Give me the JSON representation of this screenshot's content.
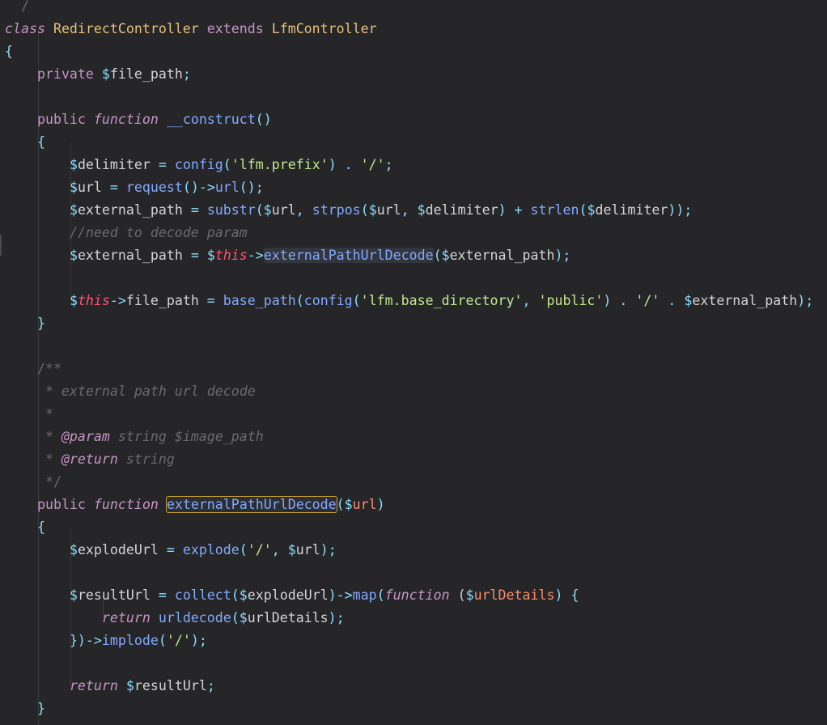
{
  "colors": {
    "background": "#262629",
    "keyword": "#c594c5",
    "class": "#e5c07b",
    "function": "#82aaff",
    "variable": "#d4d4d4",
    "string": "#c3e88d",
    "comment": "#6b6b6b",
    "this": "#ff5370",
    "param": "#f78c6c",
    "punctuation": "#89ddff",
    "highlight_border": "#c8a22c"
  },
  "lines": [
    [
      {
        "t": "  /",
        "c": "comment"
      }
    ],
    [
      {
        "t": "class",
        "c": "keyword",
        "i": true
      },
      {
        "t": " "
      },
      {
        "t": "RedirectController",
        "c": "class"
      },
      {
        "t": " "
      },
      {
        "t": "extends",
        "c": "keyword"
      },
      {
        "t": " "
      },
      {
        "t": "LfmController",
        "c": "class"
      }
    ],
    [
      {
        "t": "{",
        "c": "punctuation"
      }
    ],
    [
      {
        "t": "    "
      },
      {
        "t": "private",
        "c": "keyword"
      },
      {
        "t": " "
      },
      {
        "t": "$",
        "c": "punctuation"
      },
      {
        "t": "file_path"
      },
      {
        "t": ";",
        "c": "punctuation"
      }
    ],
    [],
    [
      {
        "t": "    "
      },
      {
        "t": "public",
        "c": "keyword"
      },
      {
        "t": " "
      },
      {
        "t": "function",
        "c": "keyword",
        "i": true
      },
      {
        "t": " "
      },
      {
        "t": "__construct",
        "c": "function"
      },
      {
        "t": "()",
        "c": "punctuation"
      }
    ],
    [
      {
        "t": "    "
      },
      {
        "t": "{",
        "c": "punctuation"
      }
    ],
    [
      {
        "t": "        "
      },
      {
        "t": "$",
        "c": "punctuation"
      },
      {
        "t": "delimiter "
      },
      {
        "t": "=",
        "c": "punctuation"
      },
      {
        "t": " "
      },
      {
        "t": "config",
        "c": "function"
      },
      {
        "t": "(",
        "c": "punctuation"
      },
      {
        "t": "'lfm.prefix'",
        "c": "string"
      },
      {
        "t": ")",
        "c": "punctuation"
      },
      {
        "t": " . ",
        "c": "punctuation"
      },
      {
        "t": "'/'",
        "c": "string"
      },
      {
        "t": ";",
        "c": "punctuation"
      }
    ],
    [
      {
        "t": "        "
      },
      {
        "t": "$",
        "c": "punctuation"
      },
      {
        "t": "url "
      },
      {
        "t": "=",
        "c": "punctuation"
      },
      {
        "t": " "
      },
      {
        "t": "request",
        "c": "function"
      },
      {
        "t": "()->",
        "c": "punctuation"
      },
      {
        "t": "url",
        "c": "function"
      },
      {
        "t": "();",
        "c": "punctuation"
      }
    ],
    [
      {
        "t": "        "
      },
      {
        "t": "$",
        "c": "punctuation"
      },
      {
        "t": "external_path "
      },
      {
        "t": "=",
        "c": "punctuation"
      },
      {
        "t": " "
      },
      {
        "t": "substr",
        "c": "function"
      },
      {
        "t": "(",
        "c": "punctuation"
      },
      {
        "t": "$",
        "c": "punctuation"
      },
      {
        "t": "url"
      },
      {
        "t": ", ",
        "c": "punctuation"
      },
      {
        "t": "strpos",
        "c": "function"
      },
      {
        "t": "(",
        "c": "punctuation"
      },
      {
        "t": "$",
        "c": "punctuation"
      },
      {
        "t": "url"
      },
      {
        "t": ", ",
        "c": "punctuation"
      },
      {
        "t": "$",
        "c": "punctuation"
      },
      {
        "t": "delimiter"
      },
      {
        "t": ") + ",
        "c": "punctuation"
      },
      {
        "t": "strlen",
        "c": "function"
      },
      {
        "t": "(",
        "c": "punctuation"
      },
      {
        "t": "$",
        "c": "punctuation"
      },
      {
        "t": "delimiter"
      },
      {
        "t": "));",
        "c": "punctuation"
      }
    ],
    [
      {
        "t": "        "
      },
      {
        "t": "//need to decode param",
        "c": "comment",
        "i": true
      }
    ],
    [
      {
        "t": "        "
      },
      {
        "t": "$",
        "c": "punctuation"
      },
      {
        "t": "external_path "
      },
      {
        "t": "=",
        "c": "punctuation"
      },
      {
        "t": " "
      },
      {
        "t": "$",
        "c": "punctuation"
      },
      {
        "t": "this",
        "c": "this",
        "i": true
      },
      {
        "t": "->",
        "c": "punctuation"
      },
      {
        "t": "externalPathUrlDecode",
        "c": "function",
        "sel": true
      },
      {
        "t": "(",
        "c": "punctuation"
      },
      {
        "t": "$",
        "c": "punctuation"
      },
      {
        "t": "external_path"
      },
      {
        "t": ");",
        "c": "punctuation"
      }
    ],
    [],
    [
      {
        "t": "        "
      },
      {
        "t": "$",
        "c": "punctuation"
      },
      {
        "t": "this",
        "c": "this",
        "i": true
      },
      {
        "t": "->",
        "c": "punctuation"
      },
      {
        "t": "file_path "
      },
      {
        "t": "=",
        "c": "punctuation"
      },
      {
        "t": " "
      },
      {
        "t": "base_path",
        "c": "function"
      },
      {
        "t": "(",
        "c": "punctuation"
      },
      {
        "t": "config",
        "c": "function"
      },
      {
        "t": "(",
        "c": "punctuation"
      },
      {
        "t": "'lfm.base_directory'",
        "c": "string"
      },
      {
        "t": ", ",
        "c": "punctuation"
      },
      {
        "t": "'public'",
        "c": "string"
      },
      {
        "t": ")",
        "c": "punctuation"
      },
      {
        "t": " . ",
        "c": "punctuation"
      },
      {
        "t": "'/'",
        "c": "string"
      },
      {
        "t": " . ",
        "c": "punctuation"
      },
      {
        "t": "$",
        "c": "punctuation"
      },
      {
        "t": "external_path"
      },
      {
        "t": ");",
        "c": "punctuation"
      }
    ],
    [
      {
        "t": "    "
      },
      {
        "t": "}",
        "c": "punctuation"
      }
    ],
    [],
    [
      {
        "t": "    "
      },
      {
        "t": "/**",
        "c": "comment"
      }
    ],
    [
      {
        "t": "     "
      },
      {
        "t": "* external path url decode",
        "c": "comment",
        "i": true
      }
    ],
    [
      {
        "t": "     "
      },
      {
        "t": "*",
        "c": "comment"
      }
    ],
    [
      {
        "t": "     "
      },
      {
        "t": "* ",
        "c": "comment"
      },
      {
        "t": "@param",
        "c": "keyword",
        "i": true
      },
      {
        "t": " string $image_path",
        "c": "comment",
        "i": true
      }
    ],
    [
      {
        "t": "     "
      },
      {
        "t": "* ",
        "c": "comment"
      },
      {
        "t": "@return",
        "c": "keyword",
        "i": true
      },
      {
        "t": " string",
        "c": "comment",
        "i": true
      }
    ],
    [
      {
        "t": "     "
      },
      {
        "t": "*/",
        "c": "comment"
      }
    ],
    [
      {
        "t": "    "
      },
      {
        "t": "public",
        "c": "keyword"
      },
      {
        "t": " "
      },
      {
        "t": "function",
        "c": "keyword",
        "i": true
      },
      {
        "t": " "
      },
      {
        "t": "externalPathUrlDecode",
        "c": "function",
        "hl": true
      },
      {
        "t": "(",
        "c": "punctuation"
      },
      {
        "t": "$",
        "c": "punctuation"
      },
      {
        "t": "url",
        "c": "param"
      },
      {
        "t": ")",
        "c": "punctuation"
      }
    ],
    [
      {
        "t": "    "
      },
      {
        "t": "{",
        "c": "punctuation"
      }
    ],
    [
      {
        "t": "        "
      },
      {
        "t": "$",
        "c": "punctuation"
      },
      {
        "t": "explodeUrl "
      },
      {
        "t": "=",
        "c": "punctuation"
      },
      {
        "t": " "
      },
      {
        "t": "explode",
        "c": "function"
      },
      {
        "t": "(",
        "c": "punctuation"
      },
      {
        "t": "'/'",
        "c": "string"
      },
      {
        "t": ", ",
        "c": "punctuation"
      },
      {
        "t": "$",
        "c": "punctuation"
      },
      {
        "t": "url"
      },
      {
        "t": ");",
        "c": "punctuation"
      }
    ],
    [],
    [
      {
        "t": "        "
      },
      {
        "t": "$",
        "c": "punctuation"
      },
      {
        "t": "resultUrl "
      },
      {
        "t": "=",
        "c": "punctuation"
      },
      {
        "t": " "
      },
      {
        "t": "collect",
        "c": "function"
      },
      {
        "t": "(",
        "c": "punctuation"
      },
      {
        "t": "$",
        "c": "punctuation"
      },
      {
        "t": "explodeUrl"
      },
      {
        "t": ")->",
        "c": "punctuation"
      },
      {
        "t": "map",
        "c": "function"
      },
      {
        "t": "(",
        "c": "punctuation"
      },
      {
        "t": "function",
        "c": "keyword",
        "i": true
      },
      {
        "t": " ("
      },
      {
        "t": "$",
        "c": "punctuation"
      },
      {
        "t": "urlDetails",
        "c": "param"
      },
      {
        "t": ") {",
        "c": "punctuation"
      }
    ],
    [
      {
        "t": "            "
      },
      {
        "t": "return",
        "c": "keyword",
        "i": true
      },
      {
        "t": " "
      },
      {
        "t": "urldecode",
        "c": "function"
      },
      {
        "t": "(",
        "c": "punctuation"
      },
      {
        "t": "$",
        "c": "punctuation"
      },
      {
        "t": "urlDetails"
      },
      {
        "t": ");",
        "c": "punctuation"
      }
    ],
    [
      {
        "t": "        "
      },
      {
        "t": "})->",
        "c": "punctuation"
      },
      {
        "t": "implode",
        "c": "function"
      },
      {
        "t": "(",
        "c": "punctuation"
      },
      {
        "t": "'/'",
        "c": "string"
      },
      {
        "t": ");",
        "c": "punctuation"
      }
    ],
    [],
    [
      {
        "t": "        "
      },
      {
        "t": "return",
        "c": "keyword",
        "i": true
      },
      {
        "t": " "
      },
      {
        "t": "$",
        "c": "punctuation"
      },
      {
        "t": "resultUrl"
      },
      {
        "t": ";",
        "c": "punctuation"
      }
    ],
    [
      {
        "t": "    "
      },
      {
        "t": "}",
        "c": "punctuation"
      }
    ]
  ]
}
